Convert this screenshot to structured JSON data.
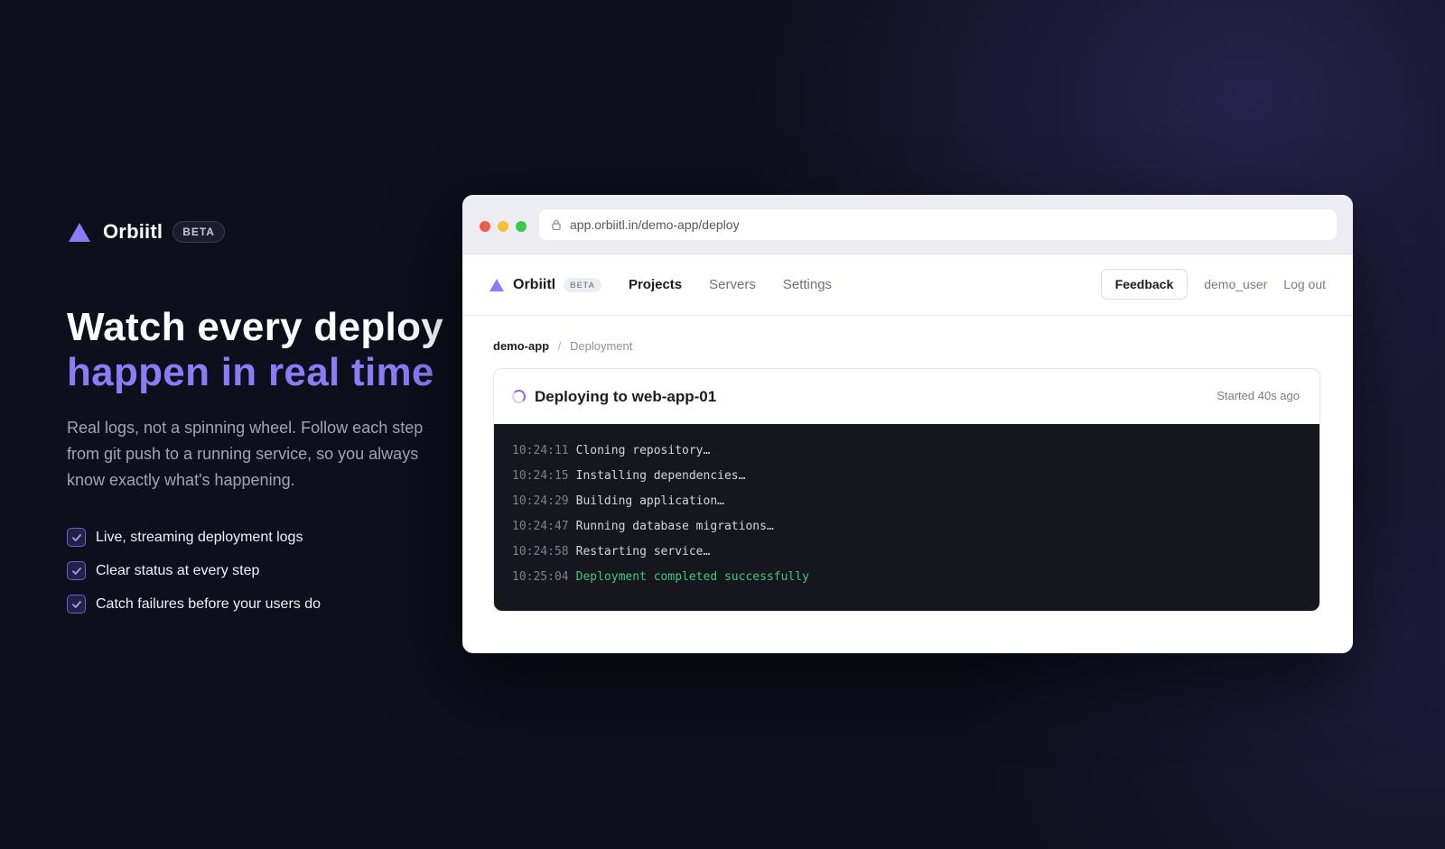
{
  "hero": {
    "brand_name": "Orbiitl",
    "badge": "BETA",
    "headline_line1": "Watch every deploy",
    "headline_line2": "happen in real time",
    "lede": "Real logs, not a spinning wheel. Follow each step from git push to a running service, so you always know exactly what's happening.",
    "features": [
      "Live, streaming deployment logs",
      "Clear status at every step",
      "Catch failures before your users do"
    ],
    "accent_color": "#8b7cf6"
  },
  "browser": {
    "url": "app.orbiitl.in/demo-app/deploy"
  },
  "app": {
    "brand_name": "Orbiitl",
    "badge": "BETA",
    "nav": [
      "Projects",
      "Servers",
      "Settings"
    ],
    "active_nav": "Projects",
    "feedback_label": "Feedback",
    "username": "demo_user",
    "logout_label": "Log out",
    "breadcrumb": {
      "project": "demo-app",
      "separator": "/",
      "page": "Deployment"
    },
    "deployment": {
      "title": "Deploying to web-app-01",
      "started": "Started 40s ago",
      "logs": [
        {
          "time": "10:24:11",
          "message": "Cloning repository…"
        },
        {
          "time": "10:24:15",
          "message": "Installing dependencies…"
        },
        {
          "time": "10:24:29",
          "message": "Building application…"
        },
        {
          "time": "10:24:47",
          "message": "Running database migrations…"
        },
        {
          "time": "10:24:58",
          "message": "Restarting service…"
        },
        {
          "time": "10:25:04",
          "message": "Deployment completed successfully"
        }
      ],
      "success_color": "#3ec97a"
    }
  }
}
